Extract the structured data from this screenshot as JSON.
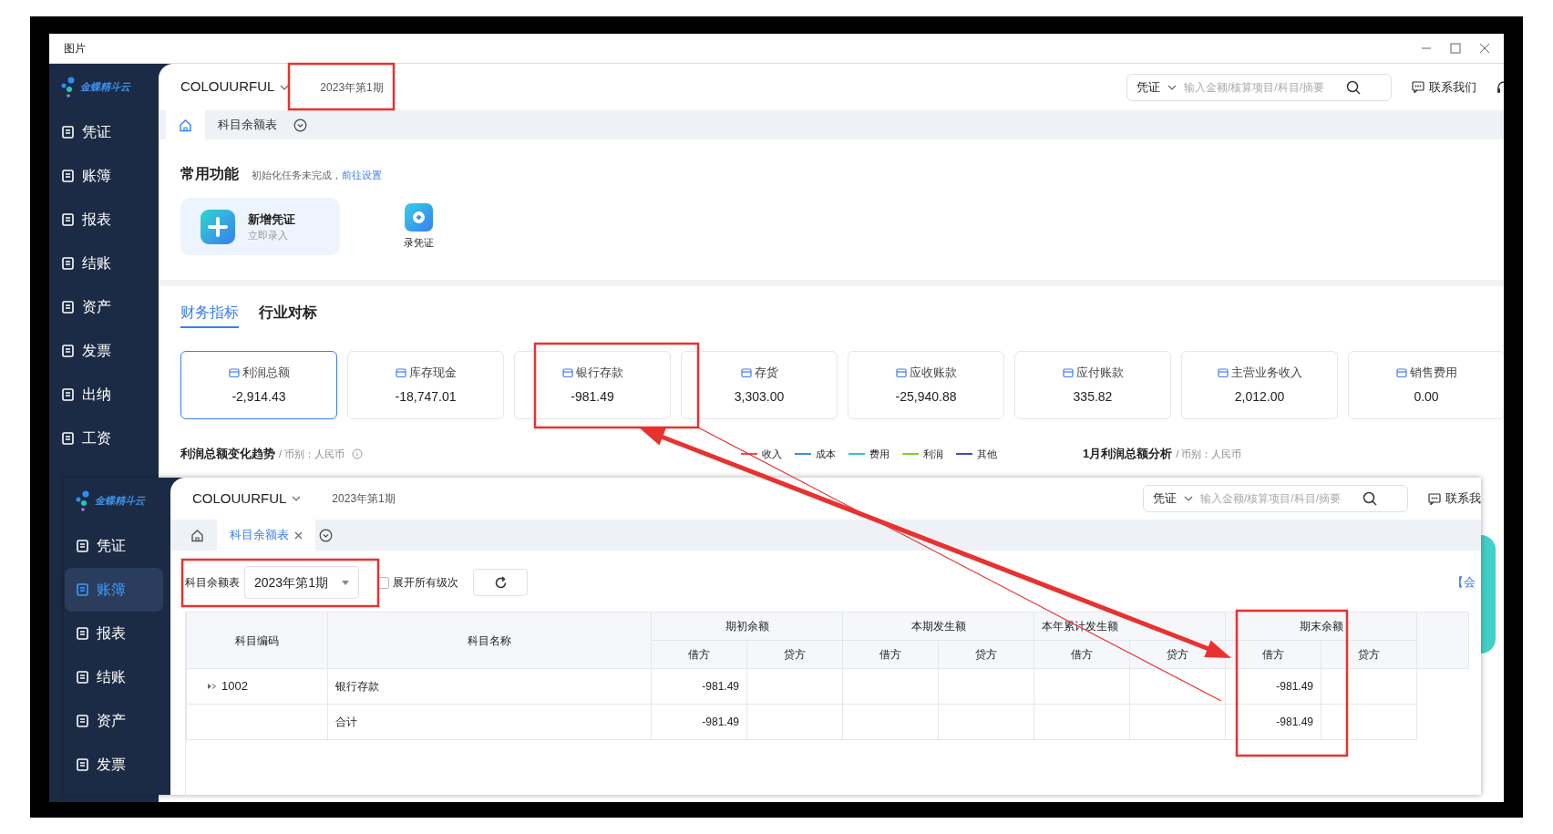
{
  "window": {
    "title": "图片"
  },
  "app": {
    "brand": "金蝶精斗云",
    "sidebar": [
      {
        "label": "凭证",
        "selected": false
      },
      {
        "label": "账簿",
        "selected": false
      },
      {
        "label": "报表",
        "selected": false
      },
      {
        "label": "结账",
        "selected": false
      },
      {
        "label": "资产",
        "selected": false
      },
      {
        "label": "发票",
        "selected": false
      },
      {
        "label": "出纳",
        "selected": false
      },
      {
        "label": "工资",
        "selected": false
      }
    ],
    "company": "COLOUURFUL",
    "period": "2023年第1期",
    "search": {
      "category": "凭证",
      "placeholder": "输入金额/核算项目/科目/摘要"
    },
    "contact": "联系我们",
    "tabs": [
      {
        "kind": "home",
        "selected": true
      },
      {
        "kind": "page",
        "label": "科目余额表",
        "selected": false
      }
    ],
    "shortcuts": {
      "title": "常用功能",
      "notice": "初始化任务未完成，",
      "link": "前往设置",
      "items": [
        {
          "kind": "card",
          "title": "新增凭证",
          "subtitle": "立即录入"
        },
        {
          "kind": "tile",
          "title": "录凭证"
        }
      ]
    },
    "section_tabs": [
      {
        "label": "财务指标",
        "selected": true
      },
      {
        "label": "行业对标",
        "selected": false
      }
    ],
    "metrics": [
      {
        "label": "利润总额",
        "value": "-2,914.43",
        "selected": true
      },
      {
        "label": "库存现金",
        "value": "-18,747.01",
        "selected": false
      },
      {
        "label": "银行存款",
        "value": "-981.49",
        "selected": false
      },
      {
        "label": "存货",
        "value": "3,303.00",
        "selected": false
      },
      {
        "label": "应收账款",
        "value": "-25,940.88",
        "selected": false
      },
      {
        "label": "应付账款",
        "value": "335.82",
        "selected": false
      },
      {
        "label": "主营业务收入",
        "value": "2,012.00",
        "selected": false
      },
      {
        "label": "销售费用",
        "value": "0.00",
        "selected": false
      }
    ],
    "trend": {
      "title": "利润总额变化趋势",
      "currency": "/ 币别：人民币",
      "legend": [
        {
          "label": "收入",
          "color": "#f04a4a"
        },
        {
          "label": "成本",
          "color": "#3a8ee6"
        },
        {
          "label": "费用",
          "color": "#2ec7c9"
        },
        {
          "label": "利润",
          "color": "#7ed321"
        },
        {
          "label": "其他",
          "color": "#3f51b5"
        }
      ]
    },
    "analysis": {
      "title": "1月利润总额分析",
      "currency": "/ 币别：人民币"
    }
  },
  "overlay_app": {
    "brand": "金蝶精斗云",
    "sidebar": [
      {
        "label": "凭证",
        "selected": false
      },
      {
        "label": "账簿",
        "selected": true
      },
      {
        "label": "报表",
        "selected": false
      },
      {
        "label": "结账",
        "selected": false
      },
      {
        "label": "资产",
        "selected": false
      },
      {
        "label": "发票",
        "selected": false
      }
    ],
    "company": "COLOUURFUL",
    "period": "2023年第1期",
    "search": {
      "category": "凭证",
      "placeholder": "输入金额/核算项目/科目/摘要"
    },
    "contact": "联系我",
    "tabs": [
      {
        "kind": "home",
        "selected": false
      },
      {
        "kind": "page",
        "label": "科目余额表",
        "selected": true
      }
    ],
    "toolbar": {
      "label": "科目余额表",
      "period": "2023年第1期",
      "expand_all": {
        "label": "展开所有级次",
        "checked": false
      }
    },
    "side_link": "【会",
    "table": {
      "columns": [
        {
          "label": "科目编码"
        },
        {
          "label": "科目名称"
        },
        {
          "label": "期初余额",
          "sub": [
            "借方",
            "贷方"
          ]
        },
        {
          "label": "本期发生额",
          "sub": [
            "借方",
            "贷方"
          ]
        },
        {
          "label": "本年累计发生额",
          "sub": [
            "借方",
            "贷方"
          ]
        },
        {
          "label": "期末余额",
          "sub": [
            "借方",
            "贷方"
          ]
        }
      ],
      "rows": [
        {
          "code": "1002",
          "expandable": true,
          "name": "银行存款",
          "opening_debit": "-981.49",
          "closing_debit": "-981.49"
        },
        {
          "expandable": false,
          "name": "合计",
          "opening_debit": "-981.49",
          "closing_debit": "-981.49"
        }
      ]
    }
  }
}
